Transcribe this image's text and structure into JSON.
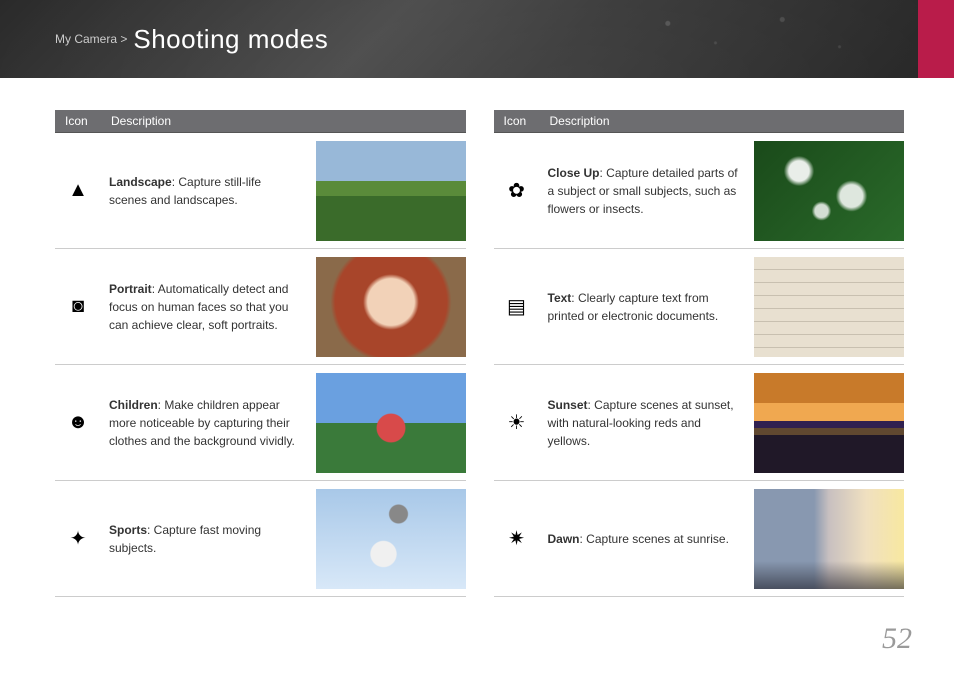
{
  "header": {
    "breadcrumb": "My Camera >",
    "title": "Shooting modes"
  },
  "table_header": {
    "icon": "Icon",
    "description": "Description"
  },
  "left": [
    {
      "icon": "landscape-icon",
      "glyph": "▲",
      "name": "Landscape",
      "desc": ": Capture still-life scenes and landscapes.",
      "thumb": "img-landscape"
    },
    {
      "icon": "portrait-icon",
      "glyph": "◙",
      "name": "Portrait",
      "desc": ": Automatically detect and focus on human faces so that you can achieve clear, soft portraits.",
      "thumb": "img-portrait"
    },
    {
      "icon": "children-icon",
      "glyph": "☻",
      "name": "Children",
      "desc": ": Make children appear more noticeable by capturing their clothes and the background vividly.",
      "thumb": "img-children"
    },
    {
      "icon": "sports-icon",
      "glyph": "✦",
      "name": "Sports",
      "desc": ": Capture fast moving subjects.",
      "thumb": "img-sports"
    }
  ],
  "right": [
    {
      "icon": "closeup-icon",
      "glyph": "✿",
      "name": "Close Up",
      "desc": ": Capture detailed parts of a subject or small subjects, such as flowers or insects.",
      "thumb": "img-closeup"
    },
    {
      "icon": "text-icon",
      "glyph": "▤",
      "name": "Text",
      "desc": ": Clearly capture text from printed or electronic documents.",
      "thumb": "img-text"
    },
    {
      "icon": "sunset-icon",
      "glyph": "☀",
      "name": "Sunset",
      "desc": ": Capture scenes at sunset, with natural-looking reds and yellows.",
      "thumb": "img-sunset"
    },
    {
      "icon": "dawn-icon",
      "glyph": "✷",
      "name": "Dawn",
      "desc": ": Capture scenes at sunrise.",
      "thumb": "img-dawn"
    }
  ],
  "page_number": "52"
}
